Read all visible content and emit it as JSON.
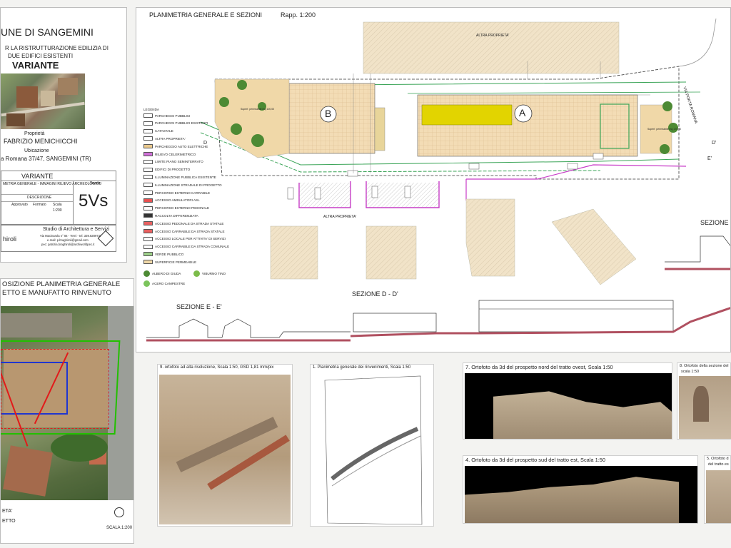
{
  "title_block": {
    "comune": "UNE DI SANGEMINI",
    "subtitle_1": "R LA RISTRUTTURAZIONE EDILIZIA DI",
    "subtitle_2": "DUE EDIFICI ESISTENTI",
    "variante_big": "VARIANTE",
    "proprieta_label": "Proprietà",
    "proprieta_name": "FABRIZIO MENICHICCHI",
    "ubicazione_label": "Ubicazione",
    "ubicazione_value": "a Romana 37/47, SANGEMINI (TR)",
    "variante_box_title": "VARIANTE",
    "variante_box_desc": "METRIA GENERALE - IMMAGINI RILIEVO ARCHEOLOGICO",
    "tavola_label": "Tavola",
    "tavola_code": "5Vs",
    "small_headers": [
      "",
      "Approvato",
      "Formato",
      "Scala"
    ],
    "small_values": [
      "",
      "",
      "",
      "1:200"
    ],
    "descrizione_label": "DESCRIZIONE",
    "studio_name": "Studio di Architettura e Servizi",
    "studio_address": "Via Macinarola n° 84 - Terni - tel. 339.8289737",
    "studio_email": "e-mail: p.braghiroli@gmail.com",
    "studio_pec": "pec: patrizia.braghiroli@archiworldpec.it",
    "author": "hiroli"
  },
  "plan": {
    "header_title": "PLANIMETRIA GENERALE  E SEZIONI",
    "header_scale": "Rapp. 1:200",
    "altra_proprieta_top": "ALTRA PROPRIETA'",
    "altra_proprieta_bottom": "ALTRA PROPRIETA'",
    "label_a": "A",
    "label_b": "B",
    "via_porta_romana": "VIA PORTA ROMANA",
    "sezione_d": "D",
    "sezione_d_prime": "D'",
    "sezione_e_prime": "E'",
    "sezione_e_title": "SEZIONE E - E'",
    "sezione_d_title": "SEZIONE D - D'",
    "sezione_right_title": "SEZIONE",
    "posti_auto_a": "Superf. permeabile mq 170,00",
    "posti_auto_b": "Superf. permeabile mq 100,00"
  },
  "legend": {
    "title": "LEGENDA",
    "items": [
      {
        "label": "PARCHEGGI PUBBLICI",
        "color": "#ffffff"
      },
      {
        "label": "PARCHEGGI PUBBLICI ESISTENTI",
        "color": "#ffffff"
      },
      {
        "label": "CATASTALE",
        "color": "#ffffff"
      },
      {
        "label": "ALTRA PROPRIETA'",
        "color": "#ffffff"
      },
      {
        "label": "PARCHEGGIO AUTO ELETTRICHE",
        "color": "#e9c88c"
      },
      {
        "label": "RILIEVO CELERIMETRICO",
        "color": "#d070d8"
      },
      {
        "label": "LIMITE PIANO SEMINTERRATO",
        "color": "#ffffff"
      },
      {
        "label": "EDIFICI DI PROGETTO",
        "color": "#ffffff"
      },
      {
        "label": "ILLUMINAZIONE PUBBLICA ESISTENTE",
        "color": "#ffffff"
      },
      {
        "label": "ILLUMINAZIONE STRADALE DI PROGETTO",
        "color": "#ffffff"
      },
      {
        "label": "PERCORSO ESTERNO CARRABILE",
        "color": "#ffffff"
      },
      {
        "label": "ACCESSO AMBULATORI ASL",
        "color": "#e85050"
      },
      {
        "label": "PERCORSO ESTERNO PEDONALE",
        "color": "#ffffff"
      },
      {
        "label": "RACCOLTA DIFFERENZIATA",
        "color": "#333333"
      },
      {
        "label": "ACCESSO PEDONALE DA STRADA STATALE",
        "color": "#e86060"
      },
      {
        "label": "ACCESSO CARRABILE DA STRADA STATALE",
        "color": "#e86060"
      },
      {
        "label": "ACCESSO LOCALE PER ATTIVITA' DI SERVIZI",
        "color": "#ffffff"
      },
      {
        "label": "ACCESSO CARRABILE DA STRADA COMUNALE",
        "color": "#ffffff"
      },
      {
        "label": "VERDE PUBBLICO",
        "color": "#9ed08a"
      },
      {
        "label": "SUPERFICIE PERMEABILE",
        "color": "#f0d8a8"
      }
    ],
    "trees": [
      {
        "label": "ALBERO DI GIUDA",
        "color": "#4d8a34"
      },
      {
        "label": "VIBURNO TINO",
        "color": "#7cbc4a"
      },
      {
        "label": "ACERO CAMPESTRE",
        "color": "#7bc45c"
      }
    ]
  },
  "overlay": {
    "title_1": "OSIZIONE PLANIMETRIA GENERALE",
    "title_2": "ETTO E MANUFATTO RINVENUTO",
    "footer_1": "ETA'",
    "footer_2": "ETTO",
    "scala": "SCALA 1:200"
  },
  "orthos": [
    {
      "caption": "9. ortofoto ad alta risoluzione, Scala 1:50, GSD 1,81 mm/pix"
    },
    {
      "caption": "1. Planimetria generale dei rinvenimenti, Scala 1:50"
    },
    {
      "caption": "7. Ortofoto da 3d del prospetto nord del tratto ovest, Scala 1:50"
    },
    {
      "caption": "8. Ortofoto della sezione del",
      "caption2": "scala 1:50"
    },
    {
      "caption": "4. Ortofoto da 3d del prospetto sud del tratto est, Scala 1:50"
    },
    {
      "caption": "5. Ortofoto d",
      "caption2": "del tratto es"
    }
  ],
  "colors": {
    "parking_fill": "#f2dcb5",
    "solar_yellow": "#e2d400",
    "green_path": "#3aa457",
    "magenta": "#c83bc8",
    "section_red": "#b05060",
    "overlay_green": "#22c000",
    "overlay_blue": "#2036d0",
    "overlay_red": "#e21a1a"
  }
}
